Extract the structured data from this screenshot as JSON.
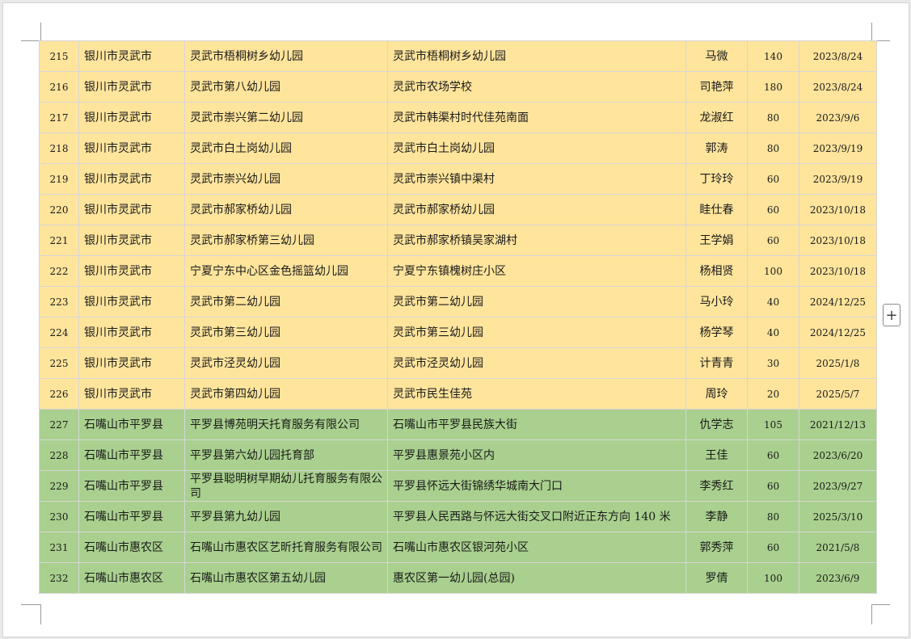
{
  "colors": {
    "row_yellow": "#ffe49c",
    "row_green": "#a9d08e"
  },
  "add_button": {
    "icon": "plus-icon",
    "glyph": "+"
  },
  "rows": [
    {
      "no": "215",
      "city": "银川市灵武市",
      "name": "灵武市梧桐树乡幼儿园",
      "address": "灵武市梧桐树乡幼儿园",
      "contact": "马微",
      "capacity": "140",
      "date": "2023/8/24",
      "color": "yellow"
    },
    {
      "no": "216",
      "city": "银川市灵武市",
      "name": "灵武市第八幼儿园",
      "address": "灵武市农场学校",
      "contact": "司艳萍",
      "capacity": "180",
      "date": "2023/8/24",
      "color": "yellow"
    },
    {
      "no": "217",
      "city": "银川市灵武市",
      "name": "灵武市崇兴第二幼儿园",
      "address": "灵武市韩渠村时代佳苑南面",
      "contact": "龙淑红",
      "capacity": "80",
      "date": "2023/9/6",
      "color": "yellow"
    },
    {
      "no": "218",
      "city": "银川市灵武市",
      "name": "灵武市白土岗幼儿园",
      "address": "灵武市白土岗幼儿园",
      "contact": "郭涛",
      "capacity": "80",
      "date": "2023/9/19",
      "color": "yellow"
    },
    {
      "no": "219",
      "city": "银川市灵武市",
      "name": "灵武市崇兴幼儿园",
      "address": "灵武市崇兴镇中渠村",
      "contact": "丁玲玲",
      "capacity": "60",
      "date": "2023/9/19",
      "color": "yellow"
    },
    {
      "no": "220",
      "city": "银川市灵武市",
      "name": "灵武市郝家桥幼儿园",
      "address": "灵武市郝家桥幼儿园",
      "contact": "眭仕春",
      "capacity": "60",
      "date": "2023/10/18",
      "color": "yellow"
    },
    {
      "no": "221",
      "city": "银川市灵武市",
      "name": "灵武市郝家桥第三幼儿园",
      "address": "灵武市郝家桥镇吴家湖村",
      "contact": "王学娟",
      "capacity": "60",
      "date": "2023/10/18",
      "color": "yellow"
    },
    {
      "no": "222",
      "city": "银川市灵武市",
      "name": "宁夏宁东中心区金色摇篮幼儿园",
      "address": "宁夏宁东镇槐树庄小区",
      "contact": "杨相贤",
      "capacity": "100",
      "date": "2023/10/18",
      "color": "yellow"
    },
    {
      "no": "223",
      "city": "银川市灵武市",
      "name": "灵武市第二幼儿园",
      "address": "灵武市第二幼儿园",
      "contact": "马小玲",
      "capacity": "40",
      "date": "2024/12/25",
      "color": "yellow"
    },
    {
      "no": "224",
      "city": "银川市灵武市",
      "name": "灵武市第三幼儿园",
      "address": "灵武市第三幼儿园",
      "contact": "杨学琴",
      "capacity": "40",
      "date": "2024/12/25",
      "color": "yellow"
    },
    {
      "no": "225",
      "city": "银川市灵武市",
      "name": "灵武市泾灵幼儿园",
      "address": "灵武市泾灵幼儿园",
      "contact": "计青青",
      "capacity": "30",
      "date": "2025/1/8",
      "color": "yellow"
    },
    {
      "no": "226",
      "city": "银川市灵武市",
      "name": "灵武市第四幼儿园",
      "address": "灵武市民生佳苑",
      "contact": "周玲",
      "capacity": "20",
      "date": "2025/5/7",
      "color": "yellow"
    },
    {
      "no": "227",
      "city": "石嘴山市平罗县",
      "name": "平罗县博苑明天托育服务有限公司",
      "address": "石嘴山市平罗县民族大街",
      "contact": "仇学志",
      "capacity": "105",
      "date": "2021/12/13",
      "color": "green"
    },
    {
      "no": "228",
      "city": "石嘴山市平罗县",
      "name": "平罗县第六幼儿园托育部",
      "address": "平罗县惠景苑小区内",
      "contact": "王佳",
      "capacity": "60",
      "date": "2023/6/20",
      "color": "green"
    },
    {
      "no": "229",
      "city": "石嘴山市平罗县",
      "name": "平罗县聪明树早期幼儿托育服务有限公司",
      "address": "平罗县怀远大街锦绣华城南大门口",
      "contact": "李秀红",
      "capacity": "60",
      "date": "2023/9/27",
      "color": "green"
    },
    {
      "no": "230",
      "city": "石嘴山市平罗县",
      "name": "平罗县第九幼儿园",
      "address": "平罗县人民西路与怀远大街交叉口附近正东方向 140 米",
      "contact": "李静",
      "capacity": "80",
      "date": "2025/3/10",
      "color": "green"
    },
    {
      "no": "231",
      "city": "石嘴山市惠农区",
      "name": "石嘴山市惠农区艺昕托育服务有限公司",
      "address": "石嘴山市惠农区银河苑小区",
      "contact": "郭秀萍",
      "capacity": "60",
      "date": "2021/5/8",
      "color": "green"
    },
    {
      "no": "232",
      "city": "石嘴山市惠农区",
      "name": "石嘴山市惠农区第五幼儿园",
      "address": "惠农区第一幼儿园(总园)",
      "contact": "罗倩",
      "capacity": "100",
      "date": "2023/6/9",
      "color": "green"
    }
  ]
}
